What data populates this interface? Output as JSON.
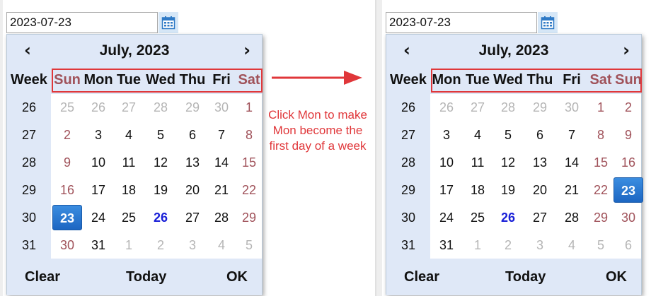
{
  "annotation": "Click Mon to make Mon become the first day of a week",
  "colors": {
    "highlight": "#e0373a",
    "weekend": "#a0525a",
    "today": "#1a20d8",
    "selected": "#1d66c2",
    "header_bg": "#dfe8f7"
  },
  "icons": {
    "calendar": "calendar-icon",
    "prev": "chevron-left-icon",
    "next": "chevron-right-icon",
    "arrow": "arrow-right-icon"
  },
  "pickers": [
    {
      "input_value": "2023-07-23",
      "month_title": "July, 2023",
      "prev_label": "‹",
      "next_label": "›",
      "week_header": "Week",
      "weekdays": [
        "Sun",
        "Mon",
        "Tue",
        "Wed",
        "Thu",
        "Fri",
        "Sat"
      ],
      "weekend_days": [
        "Sun",
        "Sat"
      ],
      "week_numbers": [
        "26",
        "27",
        "28",
        "29",
        "30",
        "31"
      ],
      "rows": [
        [
          "25",
          "26",
          "27",
          "28",
          "29",
          "30",
          "1"
        ],
        [
          "2",
          "3",
          "4",
          "5",
          "6",
          "7",
          "8"
        ],
        [
          "9",
          "10",
          "11",
          "12",
          "13",
          "14",
          "15"
        ],
        [
          "16",
          "17",
          "18",
          "19",
          "20",
          "21",
          "22"
        ],
        [
          "23",
          "24",
          "25",
          "26",
          "27",
          "28",
          "29"
        ],
        [
          "30",
          "31",
          "1",
          "2",
          "3",
          "4",
          "5"
        ]
      ],
      "other_month_cells": [
        [
          0,
          0
        ],
        [
          0,
          1
        ],
        [
          0,
          2
        ],
        [
          0,
          3
        ],
        [
          0,
          4
        ],
        [
          0,
          5
        ],
        [
          5,
          2
        ],
        [
          5,
          3
        ],
        [
          5,
          4
        ],
        [
          5,
          5
        ],
        [
          5,
          6
        ]
      ],
      "selected_cell": [
        4,
        0
      ],
      "today_cell": [
        4,
        3
      ],
      "footer": {
        "clear": "Clear",
        "today": "Today",
        "ok": "OK"
      }
    },
    {
      "input_value": "2023-07-23",
      "month_title": "July, 2023",
      "prev_label": "‹",
      "next_label": "›",
      "week_header": "Week",
      "weekdays": [
        "Mon",
        "Tue",
        "Wed",
        "Thu",
        "Fri",
        "Sat",
        "Sun"
      ],
      "weekend_days": [
        "Sat",
        "Sun"
      ],
      "week_numbers": [
        "26",
        "27",
        "28",
        "29",
        "30",
        "31"
      ],
      "rows": [
        [
          "26",
          "27",
          "28",
          "29",
          "30",
          "1",
          "2"
        ],
        [
          "3",
          "4",
          "5",
          "6",
          "7",
          "8",
          "9"
        ],
        [
          "10",
          "11",
          "12",
          "13",
          "14",
          "15",
          "16"
        ],
        [
          "17",
          "18",
          "19",
          "20",
          "21",
          "22",
          "23"
        ],
        [
          "24",
          "25",
          "26",
          "27",
          "28",
          "29",
          "30"
        ],
        [
          "31",
          "1",
          "2",
          "3",
          "4",
          "5",
          "6"
        ]
      ],
      "other_month_cells": [
        [
          0,
          0
        ],
        [
          0,
          1
        ],
        [
          0,
          2
        ],
        [
          0,
          3
        ],
        [
          0,
          4
        ],
        [
          5,
          1
        ],
        [
          5,
          2
        ],
        [
          5,
          3
        ],
        [
          5,
          4
        ],
        [
          5,
          5
        ],
        [
          5,
          6
        ]
      ],
      "selected_cell": [
        3,
        6
      ],
      "today_cell": [
        4,
        2
      ],
      "footer": {
        "clear": "Clear",
        "today": "Today",
        "ok": "OK"
      }
    }
  ]
}
